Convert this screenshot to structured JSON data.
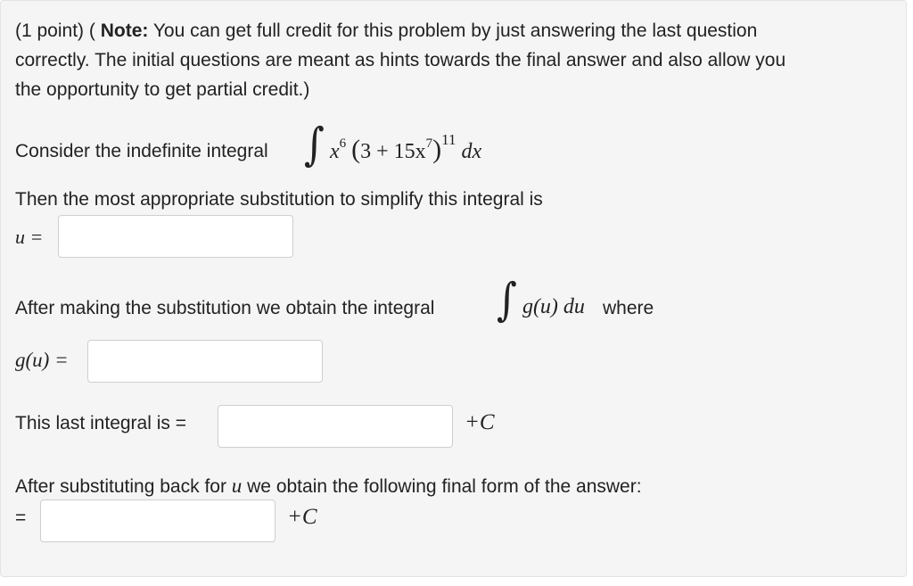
{
  "header": {
    "points": "(1 point) (",
    "note_label": "Note:",
    "line1_rest": " You can get full credit for this problem by just answering the last question",
    "line2": "correctly. The initial questions are meant as hints towards the final answer and also allow you",
    "line3": "the opportunity to get partial credit.)"
  },
  "integral_statement": {
    "text": "Consider the indefinite integral",
    "integrand": {
      "x": "x",
      "x_exp": "6",
      "open": "(",
      "body": "3 + 15x",
      "inner_exp": "7",
      "close": ")",
      "outer_exp": "11",
      "dx": "dx"
    }
  },
  "substitution": {
    "prompt": "Then the most appropriate substitution to simplify this integral is",
    "label": "u =",
    "value": ""
  },
  "after_substitution": {
    "prompt": "After making the substitution we obtain the integral",
    "integrand": "g(u) du",
    "where": "where",
    "g_label": "g(u) =",
    "value": ""
  },
  "last_integral": {
    "label": "This last integral is =",
    "value": "",
    "plus_c": "+C"
  },
  "final": {
    "prompt_before": "After substituting back for",
    "u": "u",
    "prompt_after": "we obtain the following final form of the answer:",
    "eq": "=",
    "value": "",
    "plus_c": "+C"
  }
}
